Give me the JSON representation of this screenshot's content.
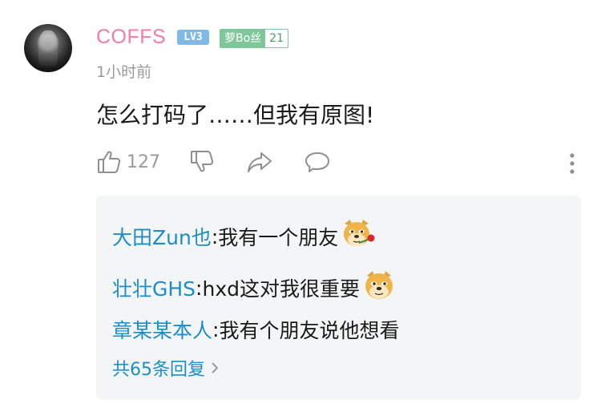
{
  "comment": {
    "username": "COFFS",
    "level_badge": "LV3",
    "fan_badge_name": "萝Bo丝",
    "fan_badge_level": "21",
    "timestamp": "1小时前",
    "text": "怎么打码了……但我有原图!",
    "like_count": "127"
  },
  "icons": [
    "thumbs-up-icon",
    "thumbs-down-icon",
    "share-icon",
    "reply-bubble-icon",
    "more-vertical-icon",
    "doge-emoji-icon",
    "doge-rose-emoji-icon",
    "chevron-right-icon"
  ],
  "colors": {
    "username": "#f27ca6",
    "link": "#1c8ec6",
    "level_badge": "#7fb9e6",
    "fan_badge": "#7ec79a",
    "reply_bg": "#f4f5f7"
  },
  "replies": [
    {
      "name": "大田Zun也",
      "separator": ":",
      "text": " 我有一个朋友"
    },
    {
      "name": "壮壮GHS",
      "separator": ":",
      "text": " hxd这对我很重要"
    },
    {
      "name": "章某某本人",
      "separator": ":",
      "text": " 我有个朋友说他想看"
    }
  ],
  "more_replies": "共65条回复"
}
